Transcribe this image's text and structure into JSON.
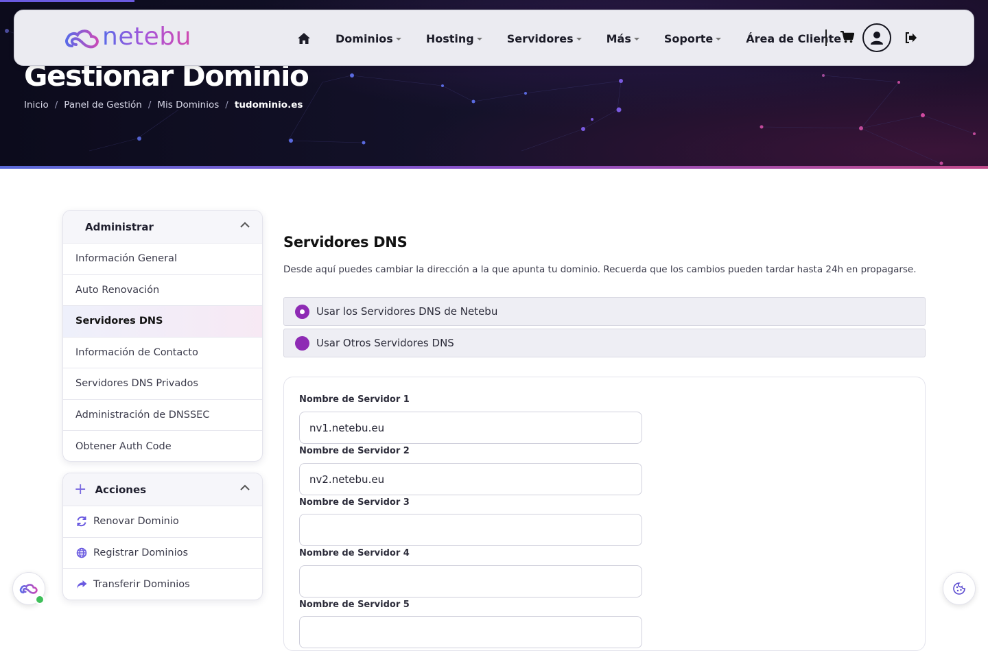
{
  "brand": {
    "logo_text": "netebu"
  },
  "nav": {
    "home_icon": "home-icon",
    "items": [
      {
        "label": "Dominios"
      },
      {
        "label": "Hosting"
      },
      {
        "label": "Servidores"
      },
      {
        "label": "Más"
      },
      {
        "label": "Soporte"
      },
      {
        "label": "Área de Cliente"
      }
    ],
    "cart_icon": "cart-icon",
    "user_icon": "user-icon",
    "logout_icon": "logout-icon"
  },
  "hero": {
    "title": "Gestionar Dominio",
    "breadcrumb": [
      "Inicio",
      "Panel de Gestión",
      "Mis Dominios",
      "tudominio.es"
    ]
  },
  "sidebar": {
    "manage": {
      "title": "Administrar",
      "items": [
        {
          "label": "Información General"
        },
        {
          "label": "Auto Renovación"
        },
        {
          "label": "Servidores DNS",
          "active": true
        },
        {
          "label": "Información de Contacto"
        },
        {
          "label": "Servidores DNS Privados"
        },
        {
          "label": "Administración de DNSSEC"
        },
        {
          "label": "Obtener Auth Code"
        }
      ]
    },
    "actions": {
      "title": "Acciones",
      "items": [
        {
          "label": "Renovar Dominio",
          "icon": "refresh-icon"
        },
        {
          "label": "Registrar Dominios",
          "icon": "globe-icon"
        },
        {
          "label": "Transferir Dominios",
          "icon": "share-arrow-icon"
        }
      ]
    }
  },
  "main": {
    "title": "Servidores DNS",
    "description": "Desde aquí puedes cambiar la dirección a la que apunta tu dominio. Recuerda que los cambios pueden tardar hasta 24h en propagarse.",
    "options": [
      {
        "label": "Usar los Servidores DNS de Netebu",
        "selected": true
      },
      {
        "label": "Usar Otros Servidores DNS",
        "selected": false
      }
    ],
    "fields": [
      {
        "label": "Nombre de Servidor 1",
        "value": "nv1.netebu.eu"
      },
      {
        "label": "Nombre de Servidor 2",
        "value": "nv2.netebu.eu"
      },
      {
        "label": "Nombre de Servidor 3",
        "value": ""
      },
      {
        "label": "Nombre de Servidor 4",
        "value": ""
      },
      {
        "label": "Nombre de Servidor 5",
        "value": ""
      }
    ]
  },
  "colors": {
    "accent": "#8e2bb4",
    "brand_gradient_start": "#5a6ae8",
    "brand_gradient_end": "#d04ab0"
  },
  "floating": {
    "left_icon": "netebu-chat-icon",
    "right_icon": "cookie-icon"
  }
}
